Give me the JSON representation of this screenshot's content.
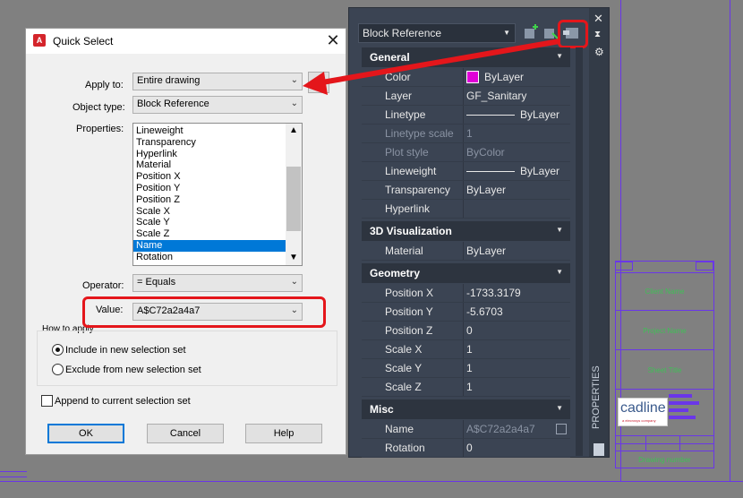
{
  "quick_select": {
    "title": "Quick Select",
    "apply_to_label": "Apply to:",
    "apply_to_value": "Entire drawing",
    "object_type_label": "Object type:",
    "object_type_value": "Block Reference",
    "properties_label": "Properties:",
    "properties": [
      "Lineweight",
      "Transparency",
      "Hyperlink",
      "Material",
      "Position X",
      "Position Y",
      "Position Z",
      "Scale X",
      "Scale Y",
      "Scale Z",
      "Name",
      "Rotation"
    ],
    "selected_property": "Name",
    "operator_label": "Operator:",
    "operator_value": "= Equals",
    "value_label": "Value:",
    "value_value": "A$C72a2a4a7",
    "how_to_apply_label": "How to apply:",
    "include_label": "Include in new selection set",
    "exclude_label": "Exclude from new selection set",
    "append_label": "Append to current selection set",
    "ok_label": "OK",
    "cancel_label": "Cancel",
    "help_label": "Help"
  },
  "properties_palette": {
    "object_selector": "Block Reference",
    "side_label": "PROPERTIES",
    "sections": [
      {
        "title": "General",
        "rows": [
          {
            "key": "Color",
            "value": "ByLayer",
            "swatch": "#e000d8"
          },
          {
            "key": "Layer",
            "value": "GF_Sanitary"
          },
          {
            "key": "Linetype",
            "value": "ByLayer",
            "line": true
          },
          {
            "key": "Linetype scale",
            "value": "1",
            "dim": true
          },
          {
            "key": "Plot style",
            "value": "ByColor",
            "dim": true
          },
          {
            "key": "Lineweight",
            "value": "ByLayer",
            "line": true
          },
          {
            "key": "Transparency",
            "value": "ByLayer"
          },
          {
            "key": "Hyperlink",
            "value": ""
          }
        ]
      },
      {
        "title": "3D Visualization",
        "rows": [
          {
            "key": "Material",
            "value": "ByLayer"
          }
        ]
      },
      {
        "title": "Geometry",
        "rows": [
          {
            "key": "Position X",
            "value": "-1733.3179"
          },
          {
            "key": "Position Y",
            "value": "-5.6703"
          },
          {
            "key": "Position Z",
            "value": "0"
          },
          {
            "key": "Scale X",
            "value": "1"
          },
          {
            "key": "Scale Y",
            "value": "1"
          },
          {
            "key": "Scale Z",
            "value": "1"
          }
        ]
      },
      {
        "title": "Misc",
        "rows": [
          {
            "key": "Name",
            "value": "A$C72a2a4a7",
            "dim_value": true
          },
          {
            "key": "Rotation",
            "value": "0"
          }
        ]
      }
    ]
  },
  "title_block": {
    "cells": [
      "Client Name",
      "Project Name",
      "Sheet Title",
      "Drawing number"
    ],
    "logo_text": "cadline",
    "logo_sub": "a  elecrosys  company"
  },
  "colors": {
    "highlight": "#e4161b",
    "selection": "#0078d7",
    "title_block_lines": "#6a36e8",
    "title_block_text": "#3fbf56"
  }
}
